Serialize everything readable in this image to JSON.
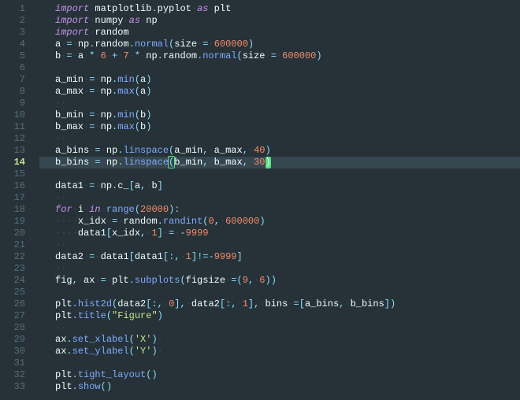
{
  "lines": [
    {
      "n": 1,
      "tokens": [
        [
          "kw",
          "import"
        ],
        [
          "ws",
          "·"
        ],
        [
          "id",
          "matplotlib"
        ],
        [
          "op",
          "."
        ],
        [
          "id",
          "pyplot"
        ],
        [
          "ws",
          "·"
        ],
        [
          "kw",
          "as"
        ],
        [
          "ws",
          "·"
        ],
        [
          "id",
          "plt"
        ]
      ]
    },
    {
      "n": 2,
      "tokens": [
        [
          "kw",
          "import"
        ],
        [
          "ws",
          "·"
        ],
        [
          "id",
          "numpy"
        ],
        [
          "ws",
          "·"
        ],
        [
          "kw",
          "as"
        ],
        [
          "ws",
          "·"
        ],
        [
          "id",
          "np"
        ]
      ]
    },
    {
      "n": 3,
      "tokens": [
        [
          "kw",
          "import"
        ],
        [
          "ws",
          "·"
        ],
        [
          "id",
          "random"
        ]
      ]
    },
    {
      "n": 4,
      "tokens": [
        [
          "id",
          "a"
        ],
        [
          "ws",
          "·"
        ],
        [
          "op",
          "="
        ],
        [
          "ws",
          "·"
        ],
        [
          "id",
          "np"
        ],
        [
          "op",
          "."
        ],
        [
          "id",
          "random"
        ],
        [
          "op",
          "."
        ],
        [
          "fn",
          "normal"
        ],
        [
          "op",
          "("
        ],
        [
          "id",
          "size"
        ],
        [
          "ws",
          "·"
        ],
        [
          "op",
          "="
        ],
        [
          "ws",
          "·"
        ],
        [
          "num",
          "600000"
        ],
        [
          "op",
          ")"
        ]
      ]
    },
    {
      "n": 5,
      "tokens": [
        [
          "id",
          "b"
        ],
        [
          "ws",
          "·"
        ],
        [
          "op",
          "="
        ],
        [
          "ws",
          "·"
        ],
        [
          "id",
          "a"
        ],
        [
          "ws",
          "·"
        ],
        [
          "op",
          "*"
        ],
        [
          "ws",
          "·"
        ],
        [
          "num",
          "6"
        ],
        [
          "ws",
          "·"
        ],
        [
          "op",
          "+"
        ],
        [
          "ws",
          "·"
        ],
        [
          "num",
          "7"
        ],
        [
          "ws",
          "·"
        ],
        [
          "op",
          "*"
        ],
        [
          "ws",
          "·"
        ],
        [
          "id",
          "np"
        ],
        [
          "op",
          "."
        ],
        [
          "id",
          "random"
        ],
        [
          "op",
          "."
        ],
        [
          "fn",
          "normal"
        ],
        [
          "op",
          "("
        ],
        [
          "id",
          "size"
        ],
        [
          "ws",
          "·"
        ],
        [
          "op",
          "="
        ],
        [
          "ws",
          "·"
        ],
        [
          "num",
          "600000"
        ],
        [
          "op",
          ")"
        ]
      ]
    },
    {
      "n": 6,
      "tokens": []
    },
    {
      "n": 7,
      "tokens": [
        [
          "id",
          "a_min"
        ],
        [
          "ws",
          "·"
        ],
        [
          "op",
          "="
        ],
        [
          "ws",
          "·"
        ],
        [
          "id",
          "np"
        ],
        [
          "op",
          "."
        ],
        [
          "fn",
          "min"
        ],
        [
          "op",
          "("
        ],
        [
          "id",
          "a"
        ],
        [
          "op",
          ")"
        ]
      ]
    },
    {
      "n": 8,
      "tokens": [
        [
          "id",
          "a_max"
        ],
        [
          "ws",
          "·"
        ],
        [
          "op",
          "="
        ],
        [
          "ws",
          "·"
        ],
        [
          "id",
          "np"
        ],
        [
          "op",
          "."
        ],
        [
          "fn",
          "max"
        ],
        [
          "op",
          "("
        ],
        [
          "id",
          "a"
        ],
        [
          "op",
          ")"
        ]
      ]
    },
    {
      "n": 9,
      "tokens": [
        [
          "ws",
          "··"
        ]
      ]
    },
    {
      "n": 10,
      "tokens": [
        [
          "id",
          "b_min"
        ],
        [
          "ws",
          "·"
        ],
        [
          "op",
          "="
        ],
        [
          "ws",
          "·"
        ],
        [
          "id",
          "np"
        ],
        [
          "op",
          "."
        ],
        [
          "fn",
          "min"
        ],
        [
          "op",
          "("
        ],
        [
          "id",
          "b"
        ],
        [
          "op",
          ")"
        ]
      ]
    },
    {
      "n": 11,
      "tokens": [
        [
          "id",
          "b_max"
        ],
        [
          "ws",
          "·"
        ],
        [
          "op",
          "="
        ],
        [
          "ws",
          "·"
        ],
        [
          "id",
          "np"
        ],
        [
          "op",
          "."
        ],
        [
          "fn",
          "max"
        ],
        [
          "op",
          "("
        ],
        [
          "id",
          "b"
        ],
        [
          "op",
          ")"
        ]
      ]
    },
    {
      "n": 12,
      "tokens": [
        [
          "ws",
          "··"
        ]
      ]
    },
    {
      "n": 13,
      "tokens": [
        [
          "id",
          "a_bins"
        ],
        [
          "ws",
          "·"
        ],
        [
          "op",
          "="
        ],
        [
          "ws",
          "·"
        ],
        [
          "id",
          "np"
        ],
        [
          "op",
          "."
        ],
        [
          "fn",
          "linspace"
        ],
        [
          "op",
          "("
        ],
        [
          "id",
          "a_min"
        ],
        [
          "op",
          ","
        ],
        [
          "ws",
          "·"
        ],
        [
          "id",
          "a_max"
        ],
        [
          "op",
          ","
        ],
        [
          "ws",
          "·"
        ],
        [
          "num",
          "40"
        ],
        [
          "op",
          ")"
        ]
      ]
    },
    {
      "n": 14,
      "active": true,
      "tokens": [
        [
          "id",
          "b_bins"
        ],
        [
          "ws",
          "·"
        ],
        [
          "op",
          "="
        ],
        [
          "ws",
          "·"
        ],
        [
          "id",
          "np"
        ],
        [
          "op",
          "."
        ],
        [
          "fn",
          "linspace"
        ],
        [
          "paren",
          "("
        ],
        [
          "id",
          "b_min"
        ],
        [
          "op",
          ","
        ],
        [
          "ws",
          "·"
        ],
        [
          "id",
          "b_max"
        ],
        [
          "op",
          ","
        ],
        [
          "ws",
          "·"
        ],
        [
          "num",
          "30"
        ],
        [
          "cursor",
          ")"
        ]
      ]
    },
    {
      "n": 15,
      "tokens": []
    },
    {
      "n": 16,
      "tokens": [
        [
          "id",
          "data1"
        ],
        [
          "ws",
          "·"
        ],
        [
          "op",
          "="
        ],
        [
          "ws",
          "·"
        ],
        [
          "id",
          "np"
        ],
        [
          "op",
          "."
        ],
        [
          "id",
          "c_"
        ],
        [
          "op",
          "["
        ],
        [
          "id",
          "a"
        ],
        [
          "op",
          ","
        ],
        [
          "ws",
          "·"
        ],
        [
          "id",
          "b"
        ],
        [
          "op",
          "]"
        ]
      ]
    },
    {
      "n": 17,
      "tokens": [
        [
          "ws",
          "··"
        ]
      ]
    },
    {
      "n": 18,
      "tokens": [
        [
          "kw",
          "for"
        ],
        [
          "ws",
          "·"
        ],
        [
          "id",
          "i"
        ],
        [
          "ws",
          "·"
        ],
        [
          "kw",
          "in"
        ],
        [
          "ws",
          "·"
        ],
        [
          "fn",
          "range"
        ],
        [
          "op",
          "("
        ],
        [
          "num",
          "20000"
        ],
        [
          "op",
          ")"
        ],
        [
          "op",
          ":"
        ]
      ]
    },
    {
      "n": 19,
      "tokens": [
        [
          "ws",
          "····"
        ],
        [
          "id",
          "x_idx"
        ],
        [
          "ws",
          "·"
        ],
        [
          "op",
          "="
        ],
        [
          "ws",
          "·"
        ],
        [
          "id",
          "random"
        ],
        [
          "op",
          "."
        ],
        [
          "fn",
          "randint"
        ],
        [
          "op",
          "("
        ],
        [
          "num",
          "0"
        ],
        [
          "op",
          ","
        ],
        [
          "ws",
          "·"
        ],
        [
          "num",
          "600000"
        ],
        [
          "op",
          ")"
        ]
      ]
    },
    {
      "n": 20,
      "tokens": [
        [
          "ws",
          "····"
        ],
        [
          "id",
          "data1"
        ],
        [
          "op",
          "["
        ],
        [
          "id",
          "x_idx"
        ],
        [
          "op",
          ","
        ],
        [
          "ws",
          "·"
        ],
        [
          "num",
          "1"
        ],
        [
          "op",
          "]"
        ],
        [
          "ws",
          "·"
        ],
        [
          "op",
          "="
        ],
        [
          "ws",
          "·"
        ],
        [
          "op",
          "-"
        ],
        [
          "num",
          "9999"
        ]
      ]
    },
    {
      "n": 21,
      "tokens": [
        [
          "ws",
          "··"
        ]
      ]
    },
    {
      "n": 22,
      "tokens": [
        [
          "id",
          "data2"
        ],
        [
          "ws",
          "·"
        ],
        [
          "op",
          "="
        ],
        [
          "ws",
          "·"
        ],
        [
          "id",
          "data1"
        ],
        [
          "op",
          "["
        ],
        [
          "id",
          "data1"
        ],
        [
          "op",
          "["
        ],
        [
          "op",
          ":"
        ],
        [
          "op",
          ","
        ],
        [
          "ws",
          "·"
        ],
        [
          "num",
          "1"
        ],
        [
          "op",
          "]"
        ],
        [
          "op",
          "!="
        ],
        [
          "op",
          "-"
        ],
        [
          "num",
          "9999"
        ],
        [
          "op",
          "]"
        ]
      ]
    },
    {
      "n": 23,
      "tokens": [
        [
          "ws",
          "··"
        ]
      ]
    },
    {
      "n": 24,
      "tokens": [
        [
          "id",
          "fig"
        ],
        [
          "op",
          ","
        ],
        [
          "ws",
          "·"
        ],
        [
          "id",
          "ax"
        ],
        [
          "ws",
          "·"
        ],
        [
          "op",
          "="
        ],
        [
          "ws",
          "·"
        ],
        [
          "id",
          "plt"
        ],
        [
          "op",
          "."
        ],
        [
          "fn",
          "subplots"
        ],
        [
          "op",
          "("
        ],
        [
          "id",
          "figsize"
        ],
        [
          "ws",
          "·"
        ],
        [
          "op",
          "="
        ],
        [
          "op",
          "("
        ],
        [
          "num",
          "9"
        ],
        [
          "op",
          ","
        ],
        [
          "ws",
          "·"
        ],
        [
          "num",
          "6"
        ],
        [
          "op",
          ")"
        ],
        [
          "op",
          ")"
        ]
      ]
    },
    {
      "n": 25,
      "tokens": []
    },
    {
      "n": 26,
      "tokens": [
        [
          "id",
          "plt"
        ],
        [
          "op",
          "."
        ],
        [
          "fn",
          "hist2d"
        ],
        [
          "op",
          "("
        ],
        [
          "id",
          "data2"
        ],
        [
          "op",
          "["
        ],
        [
          "op",
          ":"
        ],
        [
          "op",
          ","
        ],
        [
          "ws",
          "·"
        ],
        [
          "num",
          "0"
        ],
        [
          "op",
          "]"
        ],
        [
          "op",
          ","
        ],
        [
          "ws",
          "·"
        ],
        [
          "id",
          "data2"
        ],
        [
          "op",
          "["
        ],
        [
          "op",
          ":"
        ],
        [
          "op",
          ","
        ],
        [
          "ws",
          "·"
        ],
        [
          "num",
          "1"
        ],
        [
          "op",
          "]"
        ],
        [
          "op",
          ","
        ],
        [
          "ws",
          "·"
        ],
        [
          "id",
          "bins"
        ],
        [
          "ws",
          "·"
        ],
        [
          "op",
          "="
        ],
        [
          "op",
          "["
        ],
        [
          "id",
          "a_bins"
        ],
        [
          "op",
          ","
        ],
        [
          "ws",
          "·"
        ],
        [
          "id",
          "b_bins"
        ],
        [
          "op",
          "]"
        ],
        [
          "op",
          ")"
        ]
      ]
    },
    {
      "n": 27,
      "tokens": [
        [
          "id",
          "plt"
        ],
        [
          "op",
          "."
        ],
        [
          "fn",
          "title"
        ],
        [
          "op",
          "("
        ],
        [
          "str",
          "\"Figure\""
        ],
        [
          "op",
          ")"
        ]
      ]
    },
    {
      "n": 28,
      "tokens": [
        [
          "ws",
          "··"
        ]
      ]
    },
    {
      "n": 29,
      "tokens": [
        [
          "id",
          "ax"
        ],
        [
          "op",
          "."
        ],
        [
          "fn",
          "set_xlabel"
        ],
        [
          "op",
          "("
        ],
        [
          "str",
          "'X'"
        ],
        [
          "op",
          ")"
        ],
        [
          "ws",
          "·"
        ]
      ]
    },
    {
      "n": 30,
      "tokens": [
        [
          "id",
          "ax"
        ],
        [
          "op",
          "."
        ],
        [
          "fn",
          "set_ylabel"
        ],
        [
          "op",
          "("
        ],
        [
          "str",
          "'Y'"
        ],
        [
          "op",
          ")"
        ],
        [
          "ws",
          "·"
        ]
      ]
    },
    {
      "n": 31,
      "tokens": []
    },
    {
      "n": 32,
      "tokens": [
        [
          "id",
          "plt"
        ],
        [
          "op",
          "."
        ],
        [
          "fn",
          "tight_layout"
        ],
        [
          "op",
          "("
        ],
        [
          "op",
          ")"
        ]
      ]
    },
    {
      "n": 33,
      "tokens": [
        [
          "id",
          "plt"
        ],
        [
          "op",
          "."
        ],
        [
          "fn",
          "show"
        ],
        [
          "op",
          "("
        ],
        [
          "op",
          ")"
        ]
      ]
    }
  ]
}
